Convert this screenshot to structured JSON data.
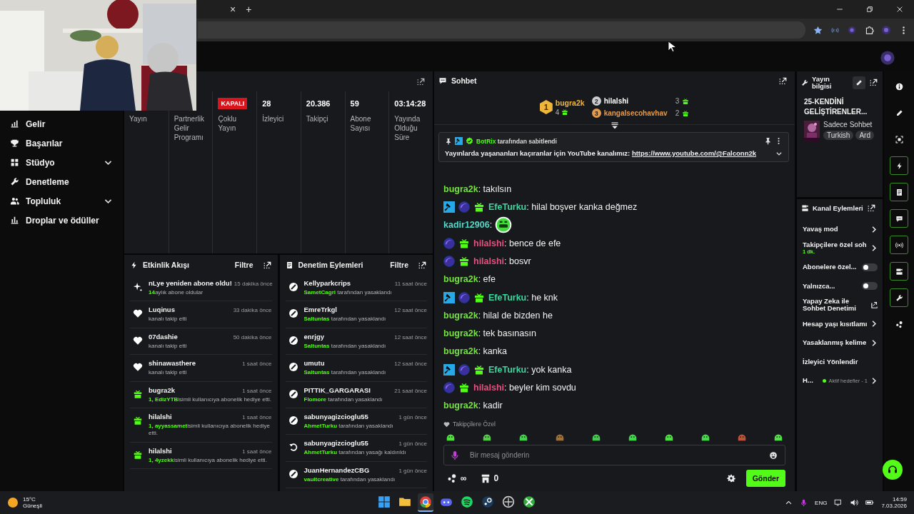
{
  "browser": {
    "tab_close": "×",
    "new_tab": "+"
  },
  "sidebar": {
    "items": [
      {
        "label": "Gelir",
        "expandable": false
      },
      {
        "label": "Başarılar",
        "expandable": false
      },
      {
        "label": "Stüdyo",
        "expandable": true
      },
      {
        "label": "Denetleme",
        "expandable": false
      },
      {
        "label": "Topluluk",
        "expandable": true
      },
      {
        "label": "Droplar ve ödüller",
        "expandable": false
      }
    ]
  },
  "stats": {
    "columns": [
      {
        "kind": "label",
        "label": "Yayın"
      },
      {
        "kind": "label",
        "label": "Partnerlik Gelir Programı"
      },
      {
        "kind": "badge",
        "value": "KAPALI",
        "label": "Çoklu Yayın"
      },
      {
        "kind": "number",
        "value": "28",
        "label": "İzleyici"
      },
      {
        "kind": "number",
        "value": "20.386",
        "label": "Takipçi"
      },
      {
        "kind": "number",
        "value": "59",
        "label": "Abone Sayısı"
      },
      {
        "kind": "number",
        "value": "03:14:28",
        "label": "Yayında Olduğu Süre"
      }
    ]
  },
  "activity": {
    "title": "Etkinlik Akışı",
    "filter": "Filtre",
    "items": [
      {
        "kind": "resub",
        "name": "nLye yeniden abone oldu!",
        "time": "15 dakika önce",
        "highlight": "14",
        "detail": "aylık abone oldular"
      },
      {
        "kind": "follow",
        "name": "Luqinus",
        "time": "33 dakika önce",
        "detail": "kanalı takip etti"
      },
      {
        "kind": "follow",
        "name": "07dashie",
        "time": "50 dakika önce",
        "detail": "kanalı takip etti"
      },
      {
        "kind": "follow",
        "name": "shinawasthere",
        "time": "1 saat önce",
        "detail": "kanalı takip etti"
      },
      {
        "kind": "gift",
        "name": "bugra2k",
        "time": "1 saat önce",
        "highlight": "1, EdizYTB",
        "detail": "isimli kullanıcıya abonelik hediye etti."
      },
      {
        "kind": "gift",
        "name": "hilalshi",
        "time": "1 saat önce",
        "highlight": "1, ayyassamet",
        "detail": "isimli kullanıcıya abonelik hediye etti."
      },
      {
        "kind": "gift",
        "name": "hilalshi",
        "time": "1 saat önce",
        "highlight": "1, 4yzekk",
        "detail": "isimli kullanıcıya abonelik hediye etti."
      }
    ]
  },
  "moderation": {
    "title": "Denetim Eylemleri",
    "filter": "Filtre",
    "items": [
      {
        "kind": "ban",
        "user": "Kellyparkcrips",
        "time": "11 saat önce",
        "by": "SametCagri",
        "action": "tarafından yasaklandı"
      },
      {
        "kind": "ban",
        "user": "EmreTrkgl",
        "time": "12 saat önce",
        "by": "Saltuntas",
        "action": "tarafından yasaklandı"
      },
      {
        "kind": "ban",
        "user": "enrjgy",
        "time": "12 saat önce",
        "by": "Saltuntas",
        "action": "tarafından yasaklandı"
      },
      {
        "kind": "ban",
        "user": "umutu",
        "time": "12 saat önce",
        "by": "Saltuntas",
        "action": "tarafından yasaklandı"
      },
      {
        "kind": "ban",
        "user": "PITTIK_GARGARASI",
        "time": "21 saat önce",
        "by": "Flomore",
        "action": "tarafından yasaklandı"
      },
      {
        "kind": "ban",
        "user": "sabunyagizcioglu55",
        "time": "1 gün önce",
        "by": "AhmetTurku",
        "action": "tarafından yasaklandı"
      },
      {
        "kind": "unban",
        "user": "sabunyagizcioglu55",
        "time": "1 gün önce",
        "by": "AhmetTurku",
        "action": "tarafından yasağı kaldırıldı"
      },
      {
        "kind": "ban",
        "user": "JuanHernandezCBG",
        "time": "1 gün önce",
        "by": "vaultcreative",
        "action": "tarafından yasaklandı"
      }
    ]
  },
  "chat": {
    "title": "Sohbet",
    "leaderboard": [
      {
        "rank": "1",
        "name": "bugra2k",
        "count": "4",
        "color": "#f0b63c"
      },
      {
        "rank": "2",
        "name": "hilalshi",
        "count": "3",
        "color": "#c9ccd1"
      },
      {
        "rank": "3",
        "name": "kangalsecohavhav",
        "count": "2",
        "color": "#e59a4a"
      }
    ],
    "pinned": {
      "by": "BotRix",
      "note": "tarafından sabitlendi",
      "text": "Yayınlarda yaşananları kaçıranlar için YouTube kanalımız:",
      "link": "https://www.youtube.com/@Falconn2k"
    },
    "messages": [
      {
        "kind": "text",
        "user": "bugra2k",
        "color": "#75e043",
        "text": ": takılsın"
      },
      {
        "kind": "text",
        "user": "EfeTurku",
        "color": "#3ad6a0",
        "badges": [
          {
            "kind": "hammer"
          },
          {
            "kind": "orb"
          },
          {
            "kind": "gift"
          }
        ],
        "text": ": hilal boşver kanka değmez"
      },
      {
        "kind": "emote",
        "user": "kadir12906",
        "color": "#52d8c8",
        "text": ":"
      },
      {
        "kind": "text",
        "user": "hilalshi",
        "color": "#e2527f",
        "badges": [
          {
            "kind": "orb"
          },
          {
            "kind": "gift"
          }
        ],
        "text": ": bence de efe"
      },
      {
        "kind": "text",
        "user": "hilalshi",
        "color": "#e2527f",
        "badges": [
          {
            "kind": "orb"
          },
          {
            "kind": "gift"
          }
        ],
        "text": ": bosvr"
      },
      {
        "kind": "text",
        "user": "bugra2k",
        "color": "#75e043",
        "text": ": efe"
      },
      {
        "kind": "text",
        "user": "EfeTurku",
        "color": "#3ad6a0",
        "badges": [
          {
            "kind": "hammer"
          },
          {
            "kind": "orb"
          },
          {
            "kind": "gift"
          }
        ],
        "text": ": he knk"
      },
      {
        "kind": "text",
        "user": "bugra2k",
        "color": "#75e043",
        "text": ": hilal de bizden he"
      },
      {
        "kind": "text",
        "user": "bugra2k",
        "color": "#75e043",
        "text": ": tek basınasın"
      },
      {
        "kind": "text",
        "user": "bugra2k",
        "color": "#75e043",
        "text": ": kanka"
      },
      {
        "kind": "text",
        "user": "EfeTurku",
        "color": "#3ad6a0",
        "badges": [
          {
            "kind": "hammer"
          },
          {
            "kind": "orb"
          },
          {
            "kind": "gift"
          }
        ],
        "text": ": yok kanka"
      },
      {
        "kind": "text",
        "user": "hilalshi",
        "color": "#e2527f",
        "badges": [
          {
            "kind": "orb"
          },
          {
            "kind": "gift"
          }
        ],
        "text": ": beyler kim sovdu"
      },
      {
        "kind": "text",
        "user": "bugra2k",
        "color": "#75e043",
        "text": ": kadir"
      }
    ],
    "emote_section": "Takipçilere Özel",
    "emotes": [
      {
        "color": "#4fe03c"
      },
      {
        "color": "#57c94a"
      },
      {
        "color": "#3fd24a"
      },
      {
        "color": "#a0703a"
      },
      {
        "color": "#45c94f"
      },
      {
        "color": "#3ed64a"
      },
      {
        "color": "#4ee043"
      },
      {
        "color": "#43d94a"
      },
      {
        "color": "#c0503a"
      },
      {
        "color": "#52e048"
      }
    ],
    "input": {
      "placeholder": "Bir mesaj gönderin"
    },
    "points": "∞",
    "store_count": "0",
    "send": "Gönder"
  },
  "stream_info": {
    "title": "Yayın bilgisi",
    "stream_title": "25-KENDİNİ GELİŞTİRENLER...",
    "category": "Sadece Sohbet",
    "tags": [
      "Turkish",
      "Ard"
    ]
  },
  "channel_actions": {
    "title": "Kanal Eylemleri",
    "items": [
      {
        "kind": "chevron",
        "label": "Yavaş mod"
      },
      {
        "kind": "chevron",
        "label": "Takipçilere özel soh",
        "sub": "1 dk."
      },
      {
        "kind": "toggle",
        "label": "Abonelere özel...",
        "on": false
      },
      {
        "kind": "toggle",
        "label": "Yalnızca...",
        "on": false
      },
      {
        "kind": "external",
        "label": "Yapay Zeka ile Sohbet Denetimi"
      },
      {
        "kind": "chevron",
        "label": "Hesap yaşı kısıtlamı"
      },
      {
        "kind": "chevron",
        "label": "Yasaklanmış kelime"
      },
      {
        "kind": "plain",
        "label": "İzleyici Yönlendir"
      },
      {
        "kind": "goal",
        "label": "H...",
        "sub": "Aktif hedefler - 1"
      }
    ]
  },
  "rail": [
    {
      "pinned": false
    },
    {
      "pinned": false
    },
    {
      "pinned": false
    },
    {
      "pinned": true
    },
    {
      "pinned": true
    },
    {
      "pinned": true
    },
    {
      "pinned": true
    },
    {
      "pinned": true
    },
    {
      "pinned": true
    },
    {
      "pinned": false
    }
  ],
  "taskbar": {
    "weather": {
      "temp": "15°C",
      "condition": "Güneşli"
    },
    "apps": [
      {
        "active": false
      },
      {
        "active": false
      },
      {
        "active": true
      },
      {
        "active": false
      },
      {
        "active": false
      },
      {
        "active": false
      },
      {
        "active": false
      },
      {
        "active": false
      }
    ],
    "lang": "ENG",
    "time": "14:59",
    "date": "7.03.2026"
  }
}
